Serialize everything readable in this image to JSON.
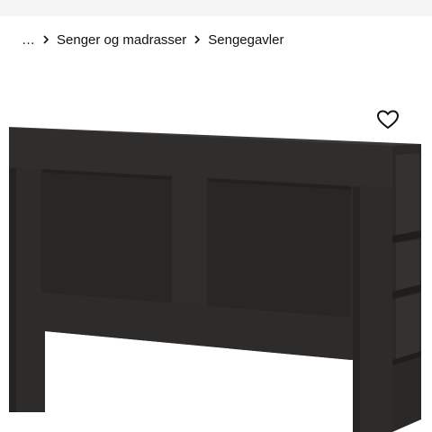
{
  "breadcrumb": {
    "items": [
      {
        "label": "…"
      },
      {
        "label": "Senger og madrasser"
      },
      {
        "label": "Sengegavler"
      }
    ]
  },
  "product": {
    "image_icon": "headboard-with-shelves",
    "color": "#2b2a29"
  },
  "favourite": {
    "icon": "heart-outline-icon"
  }
}
